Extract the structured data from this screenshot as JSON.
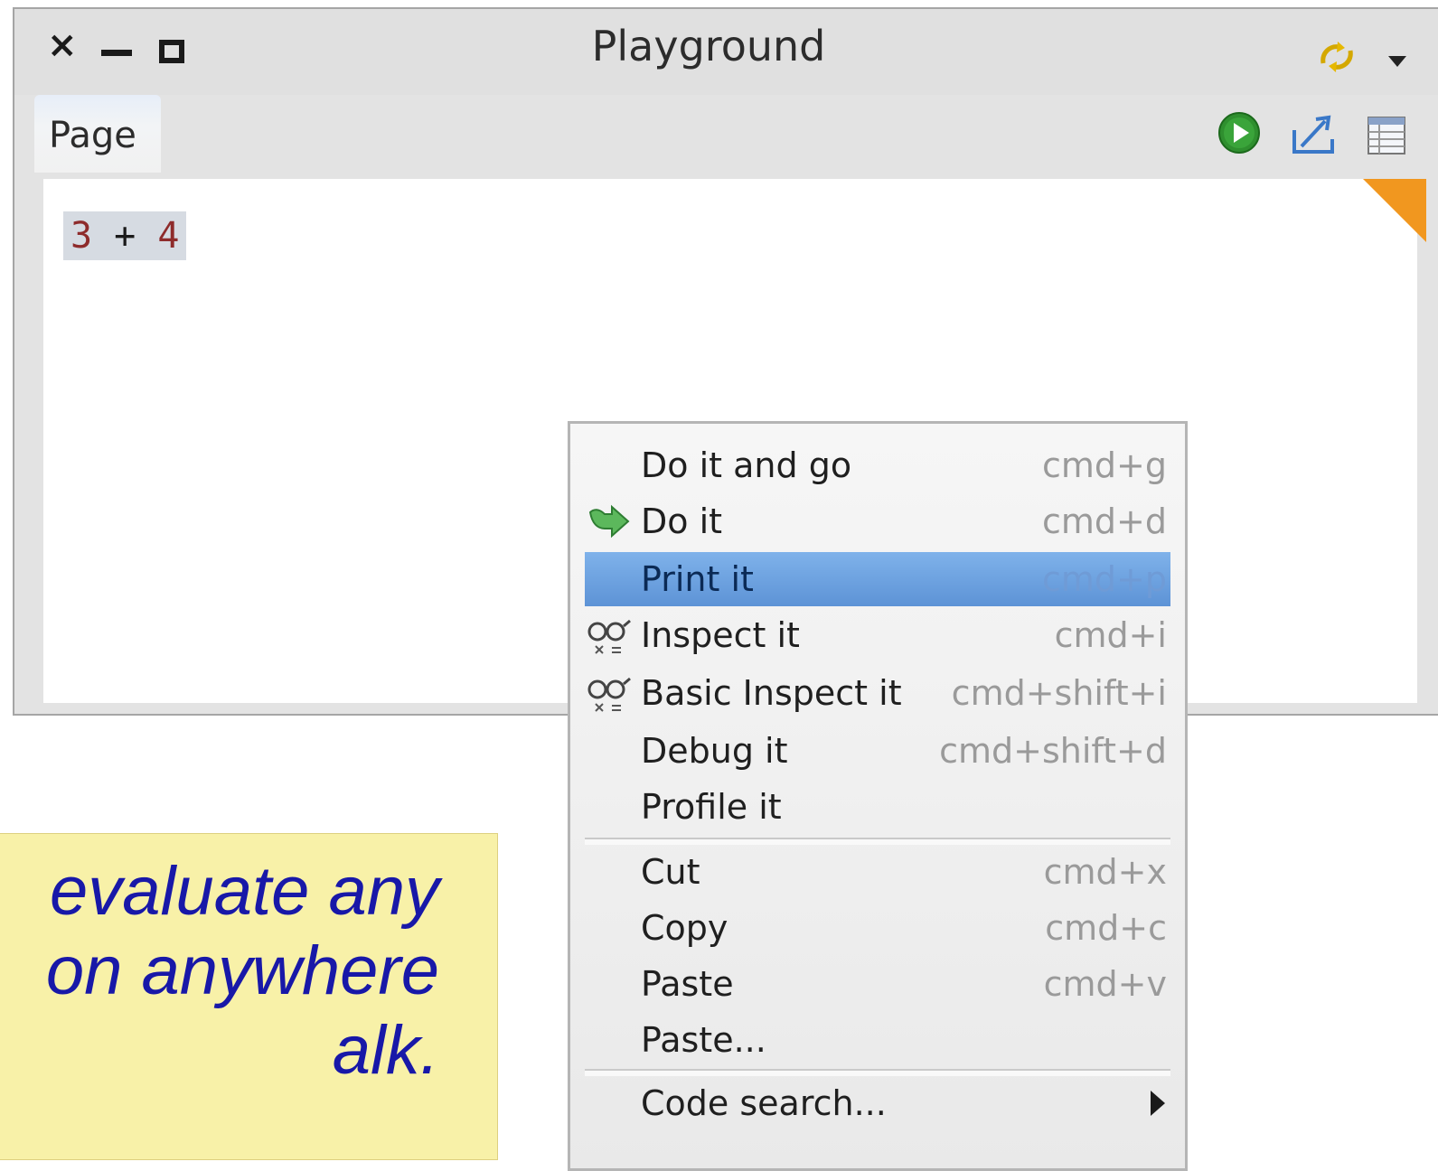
{
  "window": {
    "title": "Playground",
    "controls": [
      "close",
      "minimize",
      "maximize"
    ],
    "close_glyph": "×"
  },
  "tabs": [
    {
      "label": "Page"
    }
  ],
  "toolbar_icons": [
    "sync-icon",
    "run-icon",
    "export-icon",
    "table-icon"
  ],
  "editor": {
    "code": {
      "left": "3",
      "op": " + ",
      "right": "4"
    }
  },
  "context_menu": {
    "groups": [
      [
        {
          "label": "Do it and go",
          "shortcut": "cmd+g",
          "icon": null
        },
        {
          "label": "Do it",
          "shortcut": "cmd+d",
          "icon": "green-arrow-icon"
        },
        {
          "label": "Print it",
          "shortcut": "cmd+p",
          "icon": null,
          "highlighted": true
        },
        {
          "label": "Inspect it",
          "shortcut": "cmd+i",
          "icon": "glasses-icon"
        },
        {
          "label": "Basic Inspect it",
          "shortcut": "cmd+shift+i",
          "icon": "glasses-icon"
        },
        {
          "label": "Debug it",
          "shortcut": "cmd+shift+d",
          "icon": null
        },
        {
          "label": "Profile it",
          "shortcut": "",
          "icon": null
        }
      ],
      [
        {
          "label": "Cut",
          "shortcut": "cmd+x",
          "icon": null
        },
        {
          "label": "Copy",
          "shortcut": "cmd+c",
          "icon": null
        },
        {
          "label": "Paste",
          "shortcut": "cmd+v",
          "icon": null
        },
        {
          "label": "Paste...",
          "shortcut": "",
          "icon": null
        }
      ],
      [
        {
          "label": "Code search...",
          "shortcut": "",
          "icon": null,
          "submenu": true
        }
      ]
    ]
  },
  "note": {
    "lines": [
      "evaluate any",
      "on anywhere",
      "alk."
    ]
  },
  "colors": {
    "highlight": "#6aa0de",
    "note_bg": "#f8f1a8",
    "note_text": "#1818a8",
    "corner": "#f1971f"
  }
}
